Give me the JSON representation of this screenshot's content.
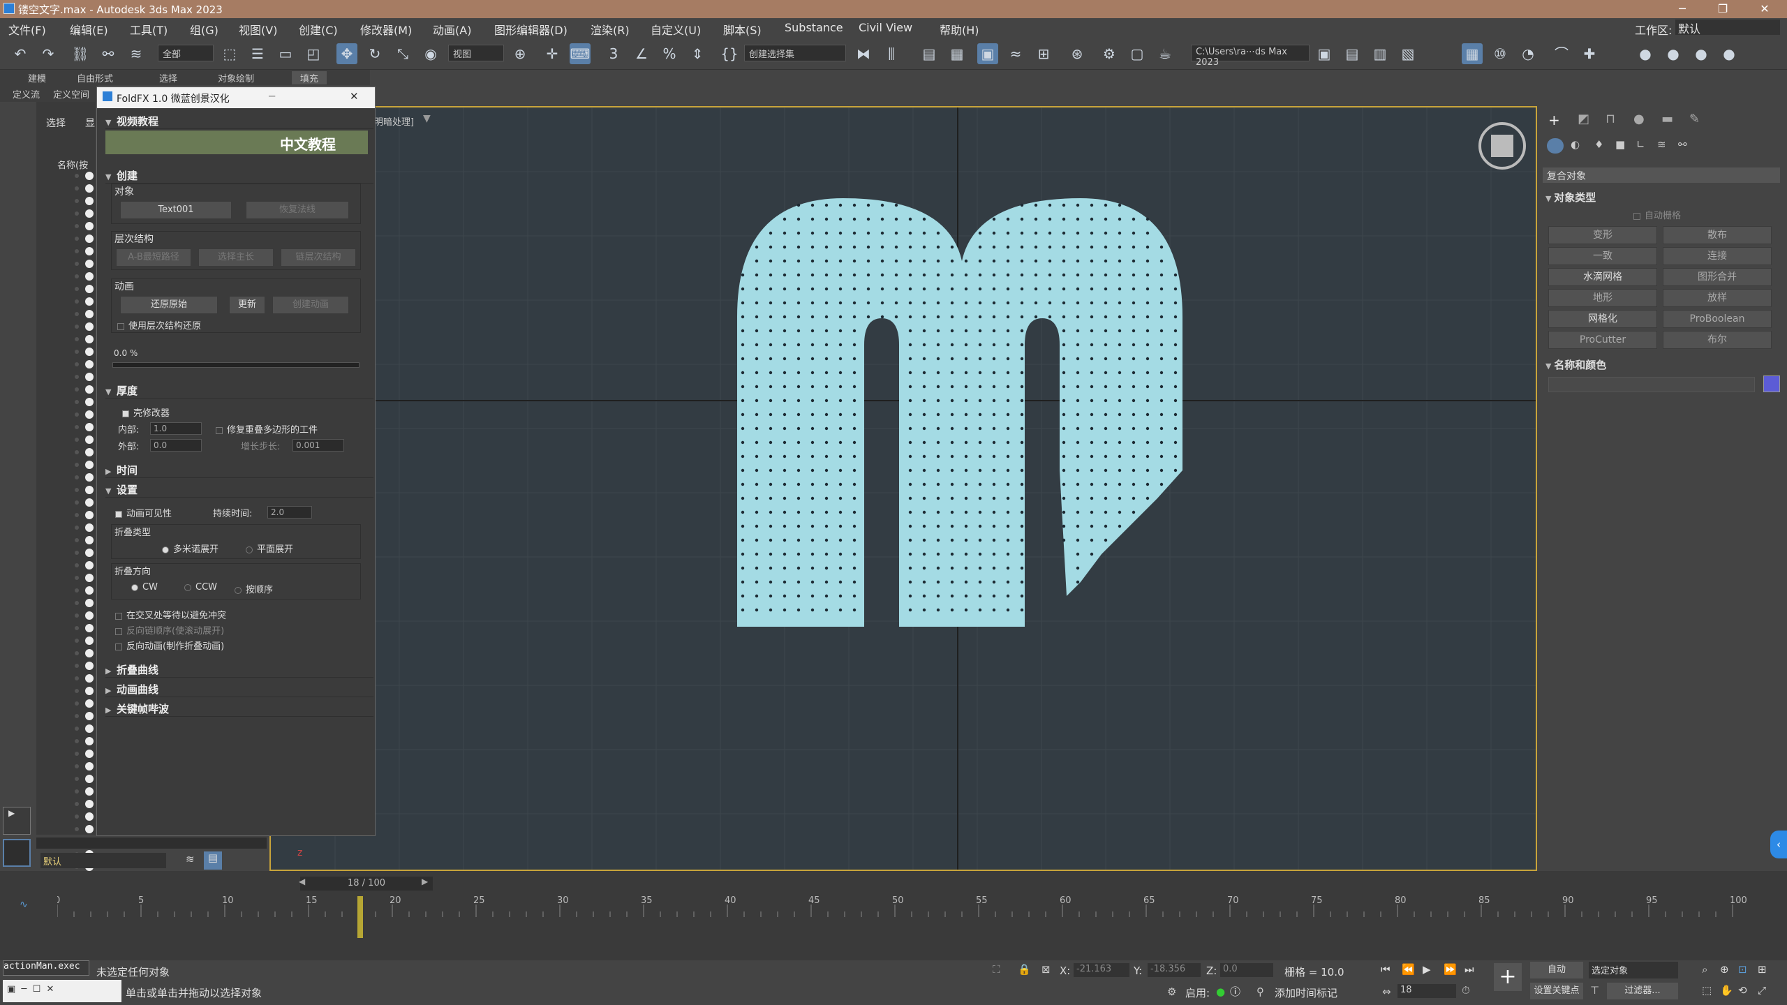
{
  "window": {
    "title": "镂空文字.max - Autodesk 3ds Max 2023"
  },
  "workspace": {
    "label": "工作区:",
    "value": "默认"
  },
  "menu": [
    "文件(F)",
    "编辑(E)",
    "工具(T)",
    "组(G)",
    "视图(V)",
    "创建(C)",
    "修改器(M)",
    "动画(A)",
    "图形编辑器(D)",
    "渲染(R)",
    "自定义(U)",
    "脚本(S)",
    "Substance",
    "Civil View",
    "帮助(H)"
  ],
  "toolbar": {
    "filter": "全部",
    "view": "视图",
    "selection_set": "创建选择集",
    "path": "C:\\Users\\ra⋯ds Max 2023"
  },
  "ribbon": {
    "tabs": [
      "建模",
      "自由形式",
      "选择",
      "对象绘制",
      "填充"
    ]
  },
  "subtabs": [
    "定义流",
    "定义空间"
  ],
  "scene": {
    "tab_select": "选择",
    "tab_display": "显",
    "col_name": "名称(按"
  },
  "viewport": {
    "label": "[+] [透视] [标准] [默认明暗处理]",
    "visible_label": "明暗处理]"
  },
  "foldfx": {
    "title": "FoldFX 1.0 微蓝创景汉化",
    "video": "视频教程",
    "banner": "中文教程",
    "create": "创建",
    "object": "对象",
    "object_btn": "Text001",
    "restore_btn": "恢复法线",
    "hierarchy": "层次结构",
    "h_btn1": "A-B最短路径",
    "h_btn2": "选择主长",
    "h_btn3": "链层次结构",
    "anim": "动画",
    "a_btn1": "还原原始",
    "a_btn2": "更新",
    "a_btn3": "创建动画",
    "use_hier": "使用层次结构还原",
    "progress": "0.0 %",
    "thickness": "厚度",
    "shell": "壳修改器",
    "inner_label": "内部:",
    "inner_val": "1.0",
    "outer_label": "外部:",
    "outer_val": "0.0",
    "fix_poly": "修复重叠多边形的工件",
    "step_label": "增长步长:",
    "step_val": "0.001",
    "time": "时间",
    "settings": "设置",
    "anim_vis": "动画可见性",
    "duration_label": "持续时间:",
    "duration_val": "2.0",
    "fold_type": "折叠类型",
    "ft_1": "多米诺展开",
    "ft_2": "平面展开",
    "fold_dir": "折叠方向",
    "fd_1": "CW",
    "fd_2": "CCW",
    "fd_3": "按顺序",
    "opt1": "在交叉处等待以避免冲突",
    "opt2": "反向链顺序(使滚动展开)",
    "opt3": "反向动画(制作折叠动画)",
    "fold_curve": "折叠曲线",
    "anim_curve": "动画曲线",
    "keyframe": "关键帧哔波"
  },
  "cmd": {
    "dropdown": "复合对象",
    "obj_type": "对象类型",
    "auto_grid": "自动栅格",
    "buttons": [
      "变形",
      "散布",
      "一致",
      "连接",
      "水滴网格",
      "图形合并",
      "地形",
      "放样",
      "网格化",
      "ProBoolean",
      "ProCutter",
      "布尔"
    ],
    "name_color": "名称和颜色"
  },
  "layer": "默认",
  "timeline": {
    "frame": "18 / 100",
    "ticks": [
      "0",
      "5",
      "10",
      "15",
      "20",
      "25",
      "30",
      "35",
      "40",
      "45",
      "50",
      "55",
      "60",
      "65",
      "70",
      "75",
      "80",
      "85",
      "90",
      "95",
      "100"
    ]
  },
  "status": {
    "script_tab": "actionMan.exec",
    "msg1": "未选定任何对象",
    "msg2": "单击或单击并拖动以选择对象",
    "x_label": "X:",
    "x_val": "-21.163",
    "y_label": "Y:",
    "y_val": "-18.356",
    "z_label": "Z:",
    "z_val": "0.0",
    "grid": "栅格 = 10.0",
    "enable": "启用:",
    "add_tag": "添加时间标记",
    "frame": "18",
    "auto": "自动",
    "set_key": "设置关键点",
    "sel": "选定对象",
    "filter": "过滤器..."
  }
}
